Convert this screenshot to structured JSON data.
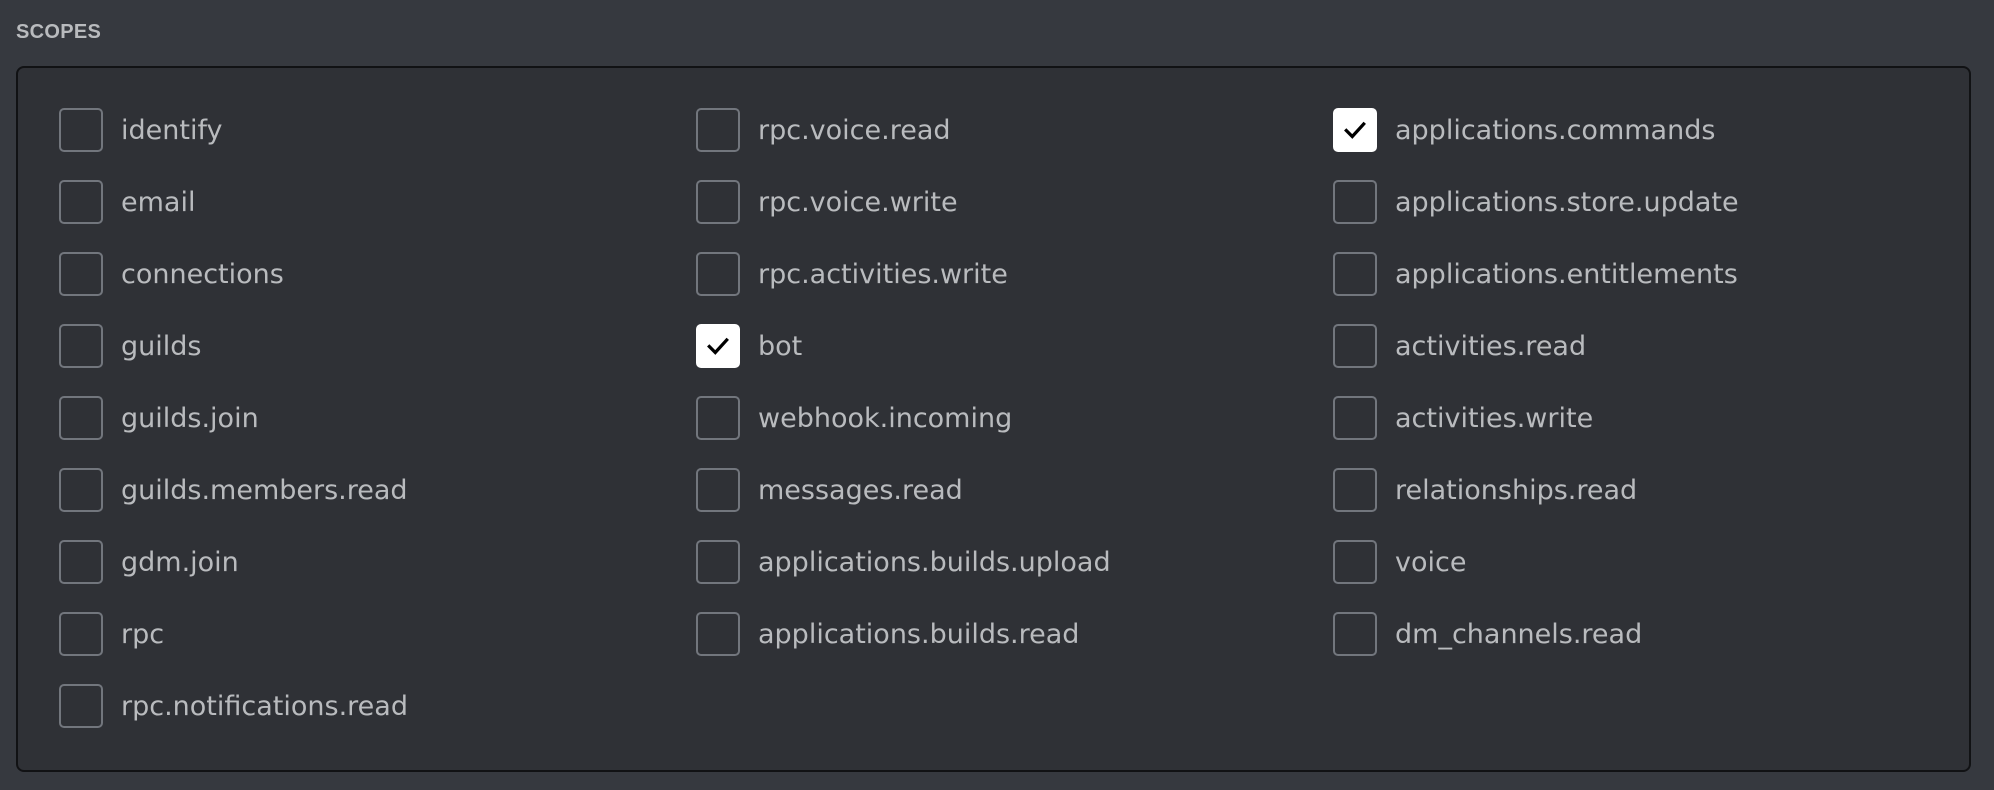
{
  "section": {
    "title": "SCOPES"
  },
  "colors": {
    "page_background": "#36393f",
    "box_background": "#2f3136",
    "box_border": "#111214",
    "label_text": "#b9bbbe",
    "checkbox_border": "#72767d",
    "checkbox_checked_fill": "#ffffff",
    "checkmark": "#000000"
  },
  "scopes": {
    "columns": [
      {
        "items": [
          {
            "label": "identify",
            "checked": false
          },
          {
            "label": "email",
            "checked": false
          },
          {
            "label": "connections",
            "checked": false
          },
          {
            "label": "guilds",
            "checked": false
          },
          {
            "label": "guilds.join",
            "checked": false
          },
          {
            "label": "guilds.members.read",
            "checked": false
          },
          {
            "label": "gdm.join",
            "checked": false
          },
          {
            "label": "rpc",
            "checked": false
          },
          {
            "label": "rpc.notifications.read",
            "checked": false
          }
        ]
      },
      {
        "items": [
          {
            "label": "rpc.voice.read",
            "checked": false
          },
          {
            "label": "rpc.voice.write",
            "checked": false
          },
          {
            "label": "rpc.activities.write",
            "checked": false
          },
          {
            "label": "bot",
            "checked": true
          },
          {
            "label": "webhook.incoming",
            "checked": false
          },
          {
            "label": "messages.read",
            "checked": false
          },
          {
            "label": "applications.builds.upload",
            "checked": false
          },
          {
            "label": "applications.builds.read",
            "checked": false
          }
        ]
      },
      {
        "items": [
          {
            "label": "applications.commands",
            "checked": true
          },
          {
            "label": "applications.store.update",
            "checked": false
          },
          {
            "label": "applications.entitlements",
            "checked": false
          },
          {
            "label": "activities.read",
            "checked": false
          },
          {
            "label": "activities.write",
            "checked": false
          },
          {
            "label": "relationships.read",
            "checked": false
          },
          {
            "label": "voice",
            "checked": false
          },
          {
            "label": "dm_channels.read",
            "checked": false
          }
        ]
      }
    ]
  }
}
